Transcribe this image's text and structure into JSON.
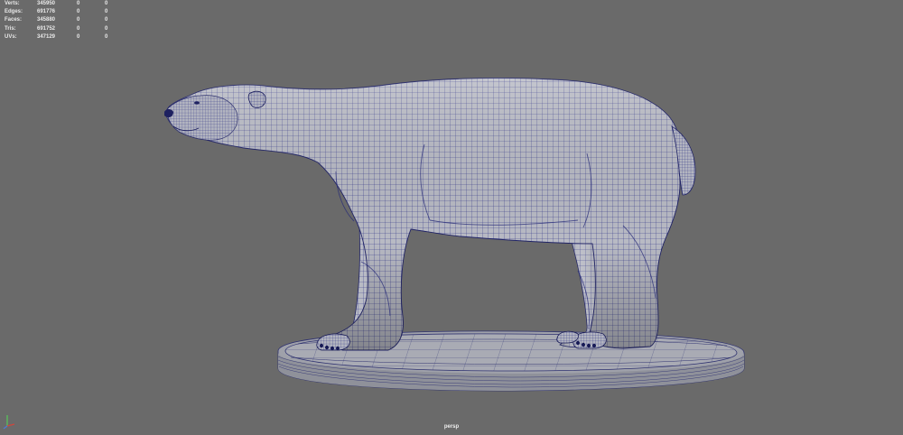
{
  "heads_up_display": {
    "rows": [
      {
        "label": "Verts:",
        "total": "345950",
        "selected": "0",
        "component": "0"
      },
      {
        "label": "Edges:",
        "total": "691776",
        "selected": "0",
        "component": "0"
      },
      {
        "label": "Faces:",
        "total": "345880",
        "selected": "0",
        "component": "0"
      },
      {
        "label": "Tris:",
        "total": "691752",
        "selected": "0",
        "component": "0"
      },
      {
        "label": "UVs:",
        "total": "347129",
        "selected": "0",
        "component": "0"
      }
    ]
  },
  "viewport": {
    "camera_name": "persp",
    "background_color": "#6a6a6a",
    "mesh_fill_color": "#b7b9c3",
    "wireframe_color": "#2b2f86"
  },
  "axis_gizmo": {
    "icon": "axis-gizmo-icon",
    "x_color": "#d0463c",
    "y_color": "#58c05c",
    "z_color": "#4d7ad8"
  }
}
